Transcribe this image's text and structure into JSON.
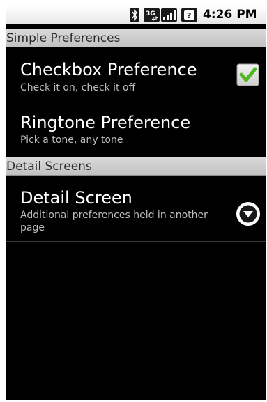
{
  "status_bar": {
    "time": "4:26 PM",
    "icons": [
      "bluetooth-icon",
      "3g-data-icon",
      "signal-icon",
      "alert-icon"
    ]
  },
  "categories": [
    {
      "title": "Simple Preferences"
    },
    {
      "title": "Detail Screens"
    }
  ],
  "preferences": {
    "checkbox": {
      "title": "Checkbox Preference",
      "summary": "Check it on, check it off",
      "checked": true
    },
    "ringtone": {
      "title": "Ringtone Preference",
      "summary": "Pick a tone, any tone"
    },
    "detail": {
      "title": "Detail Screen",
      "summary": "Additional preferences held in another page",
      "icon": "chevron-down-circle-icon"
    }
  },
  "colors": {
    "background": "#000000",
    "category_bg": "#cccccc",
    "check_green": "#4fb821",
    "summary_text": "#bdbdbd"
  }
}
